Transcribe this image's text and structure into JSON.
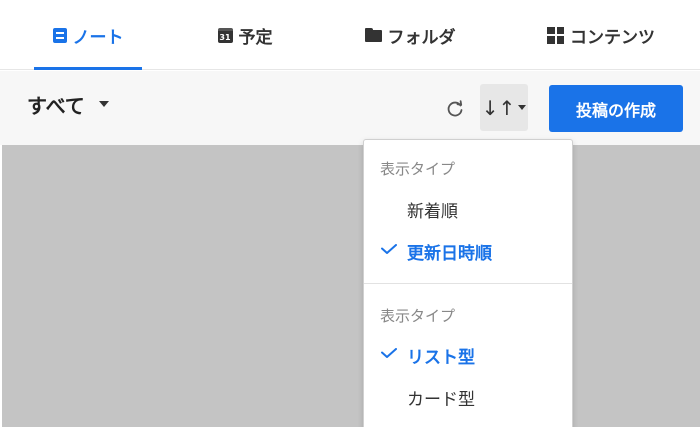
{
  "tabs": [
    {
      "label": "ノート",
      "icon": "note-icon",
      "active": true
    },
    {
      "label": "予定",
      "icon": "calendar-icon",
      "icon_text": "31",
      "active": false
    },
    {
      "label": "フォルダ",
      "icon": "folder-icon",
      "active": false
    },
    {
      "label": "コンテンツ",
      "icon": "grid-icon",
      "active": false
    }
  ],
  "toolbar": {
    "filter_label": "すべて",
    "sort_symbol": "↓↑",
    "create_label": "投稿の作成"
  },
  "dropdown": {
    "sections": [
      {
        "label": "表示タイプ",
        "items": [
          {
            "label": "新着順",
            "selected": false
          },
          {
            "label": "更新日時順",
            "selected": true
          }
        ]
      },
      {
        "label": "表示タイプ",
        "items": [
          {
            "label": "リスト型",
            "selected": true
          },
          {
            "label": "カード型",
            "selected": false
          }
        ]
      }
    ]
  },
  "colors": {
    "accent": "#1a73e8",
    "content_bg": "#c4c4c4",
    "toolbar_bg": "#f7f7f7"
  }
}
